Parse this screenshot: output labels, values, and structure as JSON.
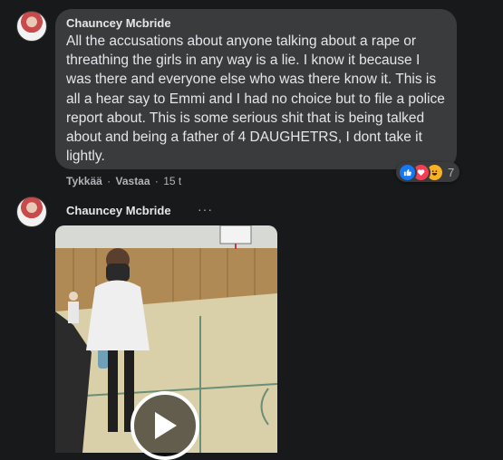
{
  "comment": {
    "author": "Chauncey Mcbride",
    "text": "All the accusations about anyone talking about a rape or threathing the girls in any way is a lie. I know it because I was there and everyone else who was there know it. This is all a hear say to Emmi and I had no choice but to file a police report about. This is some serious shit that is being talked about and being a father of 4 DAUGHETRS, I dont take it lightly.",
    "reaction_count": "7",
    "reactions": [
      "like-icon",
      "love-icon",
      "haha-icon"
    ],
    "actions": {
      "like": "Tykkää",
      "reply": "Vastaa",
      "time": "15 t"
    }
  },
  "reply_post": {
    "author": "Chauncey Mcbride",
    "more": "···",
    "media": {
      "type": "video",
      "icon": "play-icon"
    }
  },
  "colors": {
    "background": "#18191a",
    "bubble": "#3a3b3c",
    "text": "#e4e6eb",
    "secondary": "#b0b3b8",
    "like": "#1877f2",
    "love": "#f33e58",
    "haha": "#f7b125"
  }
}
